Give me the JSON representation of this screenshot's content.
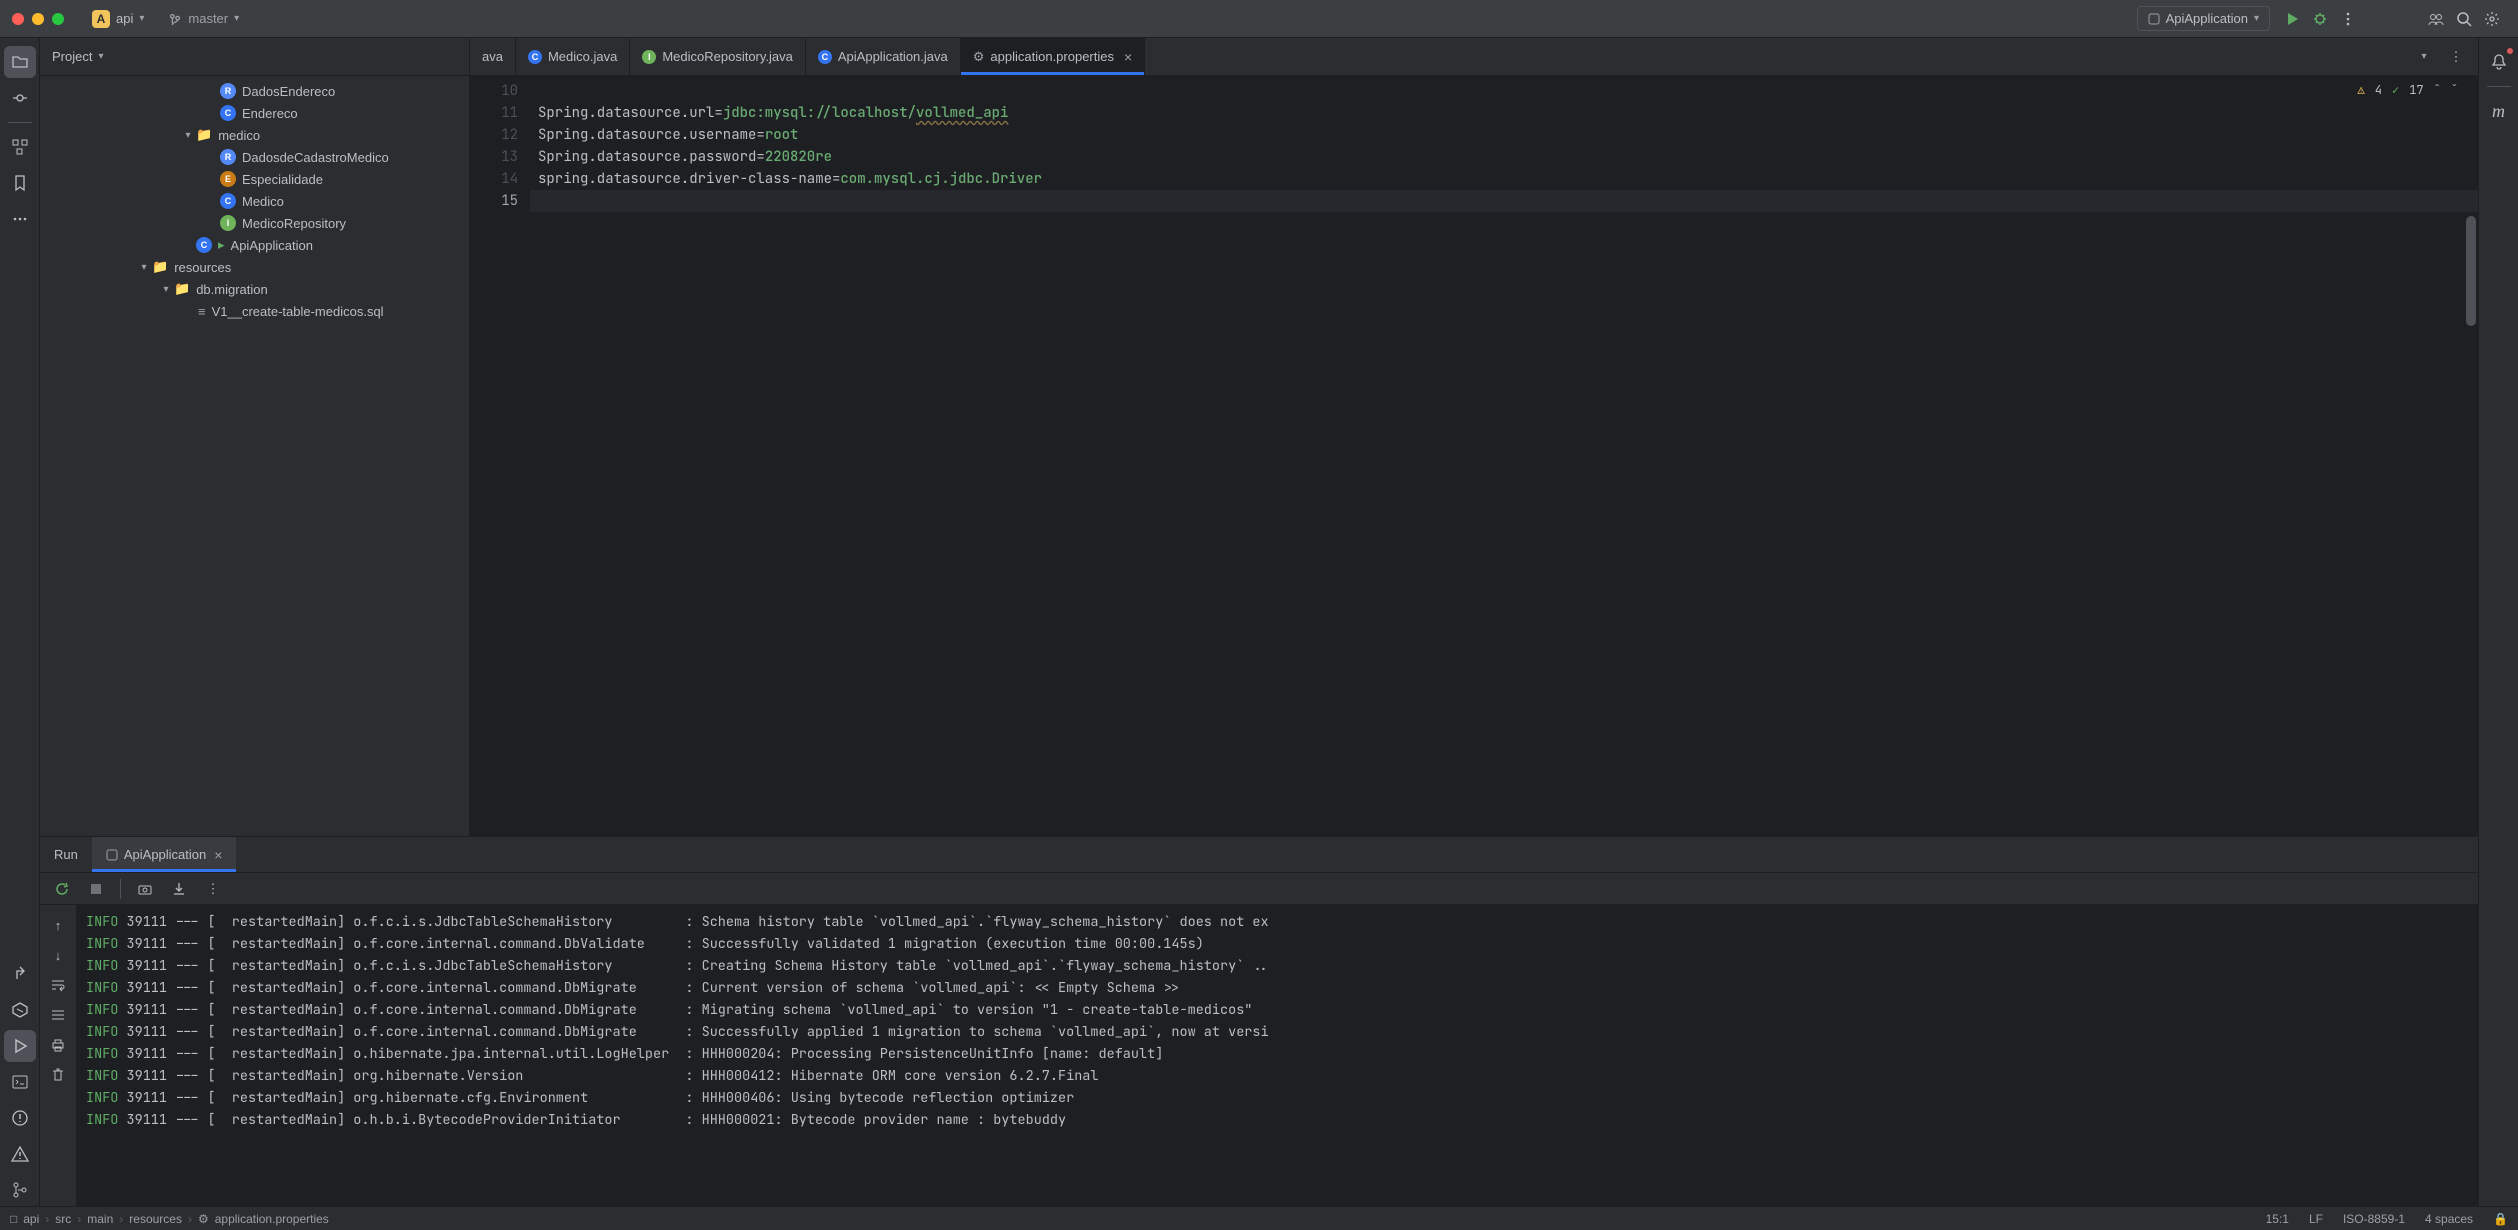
{
  "titlebar": {
    "project_badge": "A",
    "project_name": "api",
    "branch": "master",
    "run_config": "ApiApplication"
  },
  "project_panel": {
    "title": "Project",
    "tree": {
      "dados_endereco": "DadosEndereco",
      "endereco": "Endereco",
      "medico_folder": "medico",
      "dados_cadastro": "DadosdeCadastroMedico",
      "especialidade": "Especialidade",
      "medico": "Medico",
      "medico_repo": "MedicoRepository",
      "api_application": "ApiApplication",
      "resources": "resources",
      "db_migration": "db.migration",
      "v1_sql": "V1__create-table-medicos.sql"
    }
  },
  "tabs": {
    "t0": "ava",
    "t1": "Medico.java",
    "t2": "MedicoRepository.java",
    "t3": "ApiApplication.java",
    "t4": "application.properties"
  },
  "editor": {
    "gutter": [
      "10",
      "11",
      "12",
      "13",
      "14",
      "15"
    ],
    "lines": {
      "l11_key": "Spring.datasource.url=",
      "l11_val_a": "jdbc:mysql://localhost/",
      "l11_val_b": "vollmed_api",
      "l12_key": "Spring.datasource.username=",
      "l12_val": "root",
      "l13_key": "Spring.datasource.password=",
      "l13_val": "220820re",
      "l14_key": "spring.datasource.driver-class-name=",
      "l14_val": "com.mysql.cj.jdbc.Driver"
    },
    "indicators": {
      "warnings": "4",
      "ok": "17"
    }
  },
  "run_panel": {
    "tab_run": "Run",
    "tab_app": "ApiApplication"
  },
  "console": [
    "INFO 39111 --- [  restartedMain] o.f.c.i.s.JdbcTableSchemaHistory         : Schema history table `vollmed_api`.`flyway_schema_history` does not ex",
    "INFO 39111 --- [  restartedMain] o.f.core.internal.command.DbValidate     : Successfully validated 1 migration (execution time 00:00.145s)",
    "INFO 39111 --- [  restartedMain] o.f.c.i.s.JdbcTableSchemaHistory         : Creating Schema History table `vollmed_api`.`flyway_schema_history` ..",
    "INFO 39111 --- [  restartedMain] o.f.core.internal.command.DbMigrate      : Current version of schema `vollmed_api`: << Empty Schema >>",
    "INFO 39111 --- [  restartedMain] o.f.core.internal.command.DbMigrate      : Migrating schema `vollmed_api` to version \"1 - create-table-medicos\"",
    "INFO 39111 --- [  restartedMain] o.f.core.internal.command.DbMigrate      : Successfully applied 1 migration to schema `vollmed_api`, now at versi",
    "INFO 39111 --- [  restartedMain] o.hibernate.jpa.internal.util.LogHelper  : HHH000204: Processing PersistenceUnitInfo [name: default]",
    "INFO 39111 --- [  restartedMain] org.hibernate.Version                    : HHH000412: Hibernate ORM core version 6.2.7.Final",
    "INFO 39111 --- [  restartedMain] org.hibernate.cfg.Environment            : HHH000406: Using bytecode reflection optimizer",
    "INFO 39111 --- [  restartedMain] o.h.b.i.BytecodeProviderInitiator        : HHH000021: Bytecode provider name : bytebuddy"
  ],
  "status": {
    "breadcrumb": [
      "api",
      "src",
      "main",
      "resources",
      "application.properties"
    ],
    "cursor": "15:1",
    "line_sep": "LF",
    "encoding": "ISO-8859-1",
    "indent": "4 spaces"
  }
}
